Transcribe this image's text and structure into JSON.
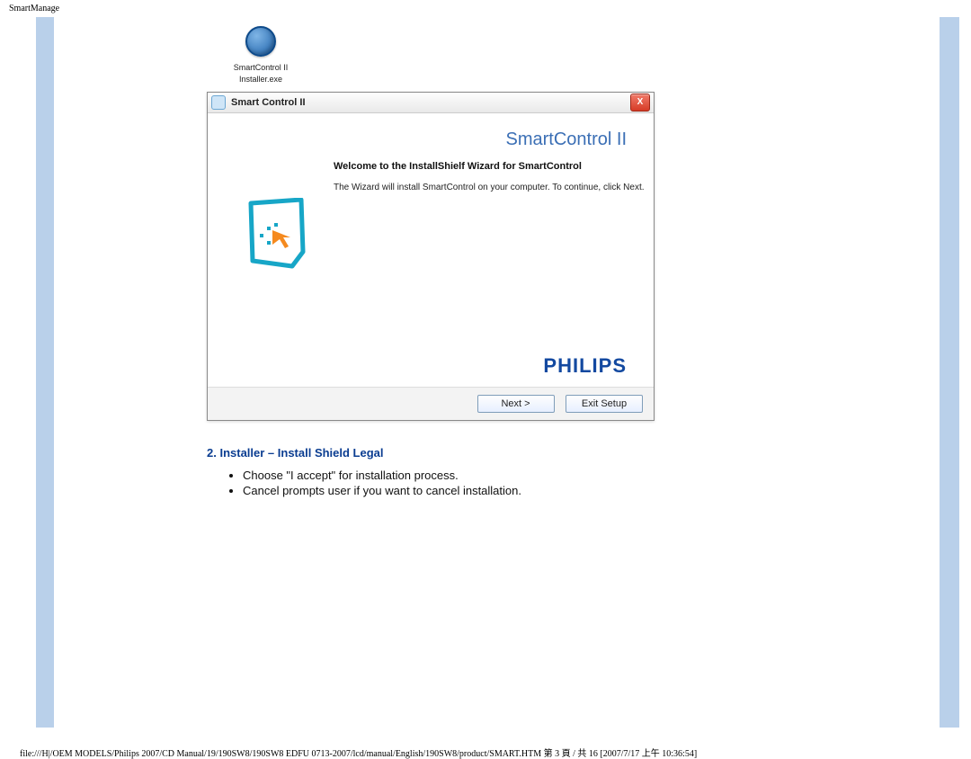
{
  "pageHeader": "SmartManage",
  "desktopIcon": {
    "line1": "SmartControl II",
    "line2": "Installer.exe"
  },
  "installer": {
    "titlebar": "Smart Control II",
    "brand": "SmartControl II",
    "welcome": "Welcome to the InstallShielf Wizard for SmartControl",
    "desc": "The Wizard will install SmartControl on your computer. To continue, click Next.",
    "logo": "PHILIPS",
    "nextBtn": "Next  >",
    "exitBtn": "Exit Setup",
    "closeX": "X"
  },
  "section": {
    "heading": "2. Installer – Install Shield Legal",
    "bullet1": "Choose \"I accept\" for installation process.",
    "bullet2": "Cancel prompts user if you want to cancel installation."
  },
  "footer": "file:///H|/OEM MODELS/Philips 2007/CD Manual/19/190SW8/190SW8 EDFU 0713-2007/lcd/manual/English/190SW8/product/SMART.HTM 第 3 頁 / 共 16  [2007/7/17 上午 10:36:54]"
}
